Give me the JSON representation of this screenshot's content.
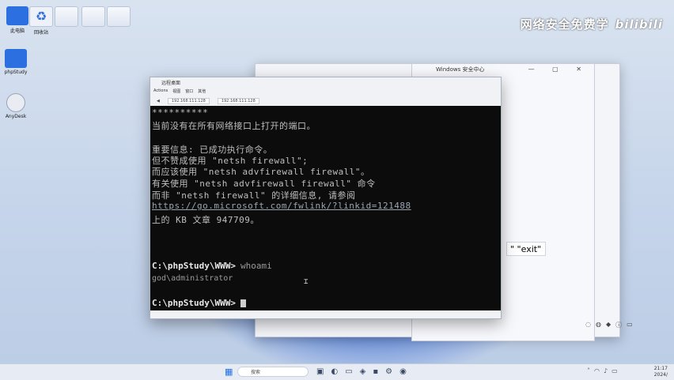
{
  "watermark": {
    "text": "网络安全免费学",
    "brand": "bilibili"
  },
  "desktop_icons": [
    {
      "label": "此电脑"
    },
    {
      "label": "回收站"
    },
    {
      "label": ""
    },
    {
      "label": ""
    },
    {
      "label": ""
    },
    {
      "label": "phpStudy"
    },
    {
      "label": "AnyDesk"
    }
  ],
  "bg_window": {
    "title": "Windows 安全中心",
    "controls": "— ▢ ✕"
  },
  "exit_label": "\" \"exit\"",
  "rdp": {
    "title": "远程桌面",
    "menu": [
      "Actions",
      "视图",
      "窗口",
      "其他"
    ],
    "tabs": [
      "192.168.111.128",
      "192.168.111.128"
    ],
    "back_label": "◀"
  },
  "terminal": {
    "lines": [
      "**********",
      "当前没有在所有网络接口上打开的端口。",
      "",
      "重要信息: 已成功执行命令。",
      "但不赞成使用 \"netsh firewall\";",
      "而应该使用 \"netsh advfirewall firewall\"。",
      "有关使用 \"netsh advfirewall firewall\" 命令",
      "而非 \"netsh firewall\" 的详细信息, 请参阅",
      "https://go.microsoft.com/fwlink/?linkid=121488",
      "上的 KB 文章 947709。"
    ],
    "prompt1": "C:\\phpStudy\\WWW>",
    "command1": "whoami",
    "output1": "god\\administrator",
    "prompt2": "C:\\phpStudy\\WWW>"
  },
  "taskbar": {
    "search_placeholder": "搜索",
    "time": "21:17",
    "date": "2024/"
  }
}
